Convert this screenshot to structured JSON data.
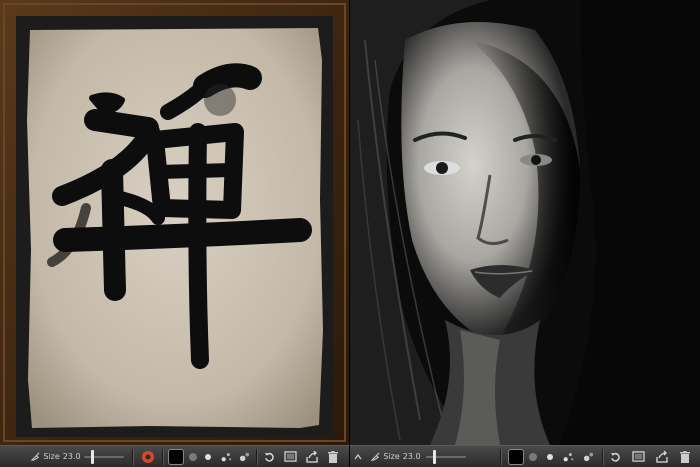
{
  "left_panel": {
    "artwork": "calligraphy",
    "frame_color": "#4a2e14",
    "paper_color": "#c9bfb0",
    "ink_color": "#0d0d0d"
  },
  "right_panel": {
    "artwork": "ink-portrait",
    "background_color": "#0a0a0a"
  },
  "toolbar_left": {
    "size_label": "Size",
    "size_value": "23.0",
    "brush_level": 0.18,
    "icons": [
      "brush-icon",
      "color-wheel-icon",
      "black-color-well",
      "gray-dot-icon",
      "white-dot-icon",
      "tool-dots-icon",
      "smudge-icon",
      "undo-icon",
      "canvas-icon",
      "share-icon",
      "trash-icon"
    ]
  },
  "toolbar_right": {
    "size_label": "Size",
    "size_value": "23.0",
    "brush_level": 0.18,
    "icons": [
      "chevron-up-icon",
      "brush-icon",
      "black-color-well",
      "gray-dot-icon",
      "white-dot-icon",
      "tool-dots-icon",
      "smudge-icon",
      "undo-icon",
      "canvas-icon",
      "share-icon",
      "trash-icon"
    ]
  },
  "colors": {
    "toolbar_top": "#4a4a4a",
    "toolbar_bottom": "#2b2b2b",
    "accent_red": "#d8482a"
  }
}
